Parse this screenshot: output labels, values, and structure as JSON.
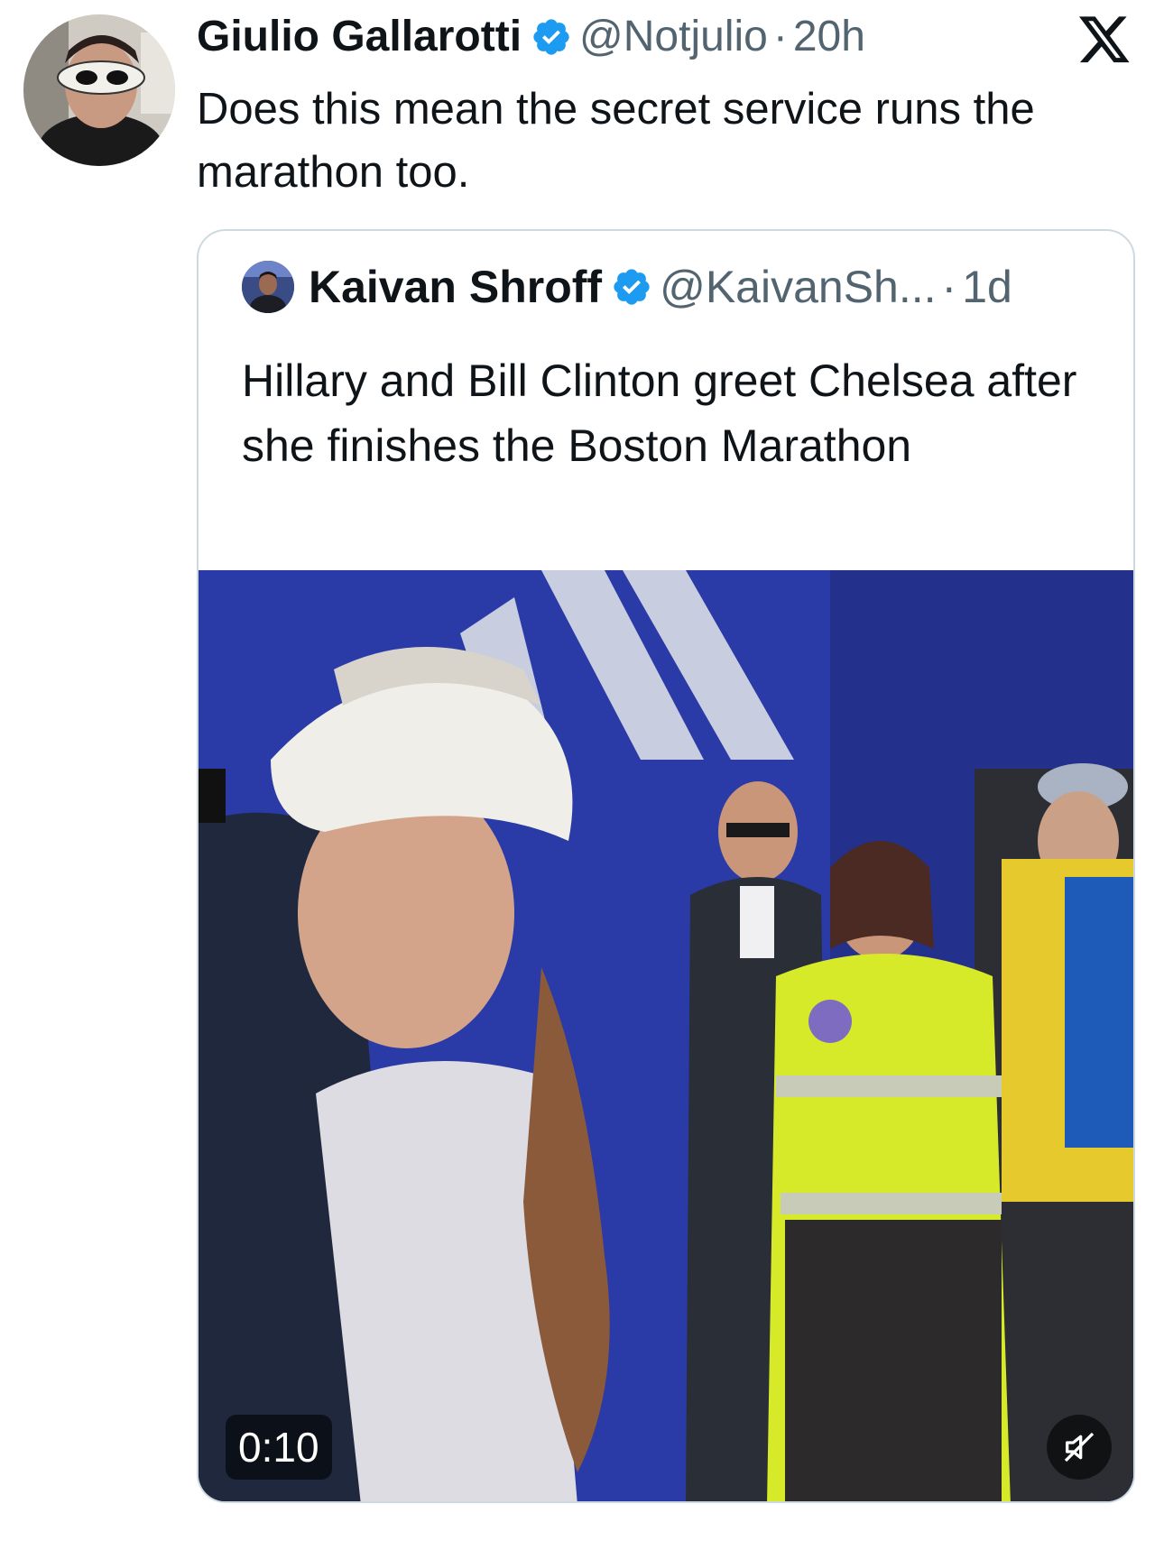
{
  "tweet": {
    "author_name": "Giulio Gallarotti",
    "author_handle": "@Notjulio",
    "separator": "·",
    "time": "20h",
    "text": "Does this mean the secret service runs the marathon too."
  },
  "quoted_tweet": {
    "author_name": "Kaivan Shroff",
    "author_handle": "@KaivanSh...",
    "separator": "·",
    "time": "1d",
    "text": "Hillary and Bill Clinton greet Chelsea after she finishes the Boston Marathon",
    "video": {
      "duration": "0:10"
    }
  },
  "icons": {
    "verified": "verified-badge-icon",
    "platform": "x-logo-icon",
    "mute": "muted-speaker-icon"
  },
  "colors": {
    "verified_blue": "#1d9bf0",
    "secondary_text": "#536471",
    "border": "#cfd9de"
  }
}
